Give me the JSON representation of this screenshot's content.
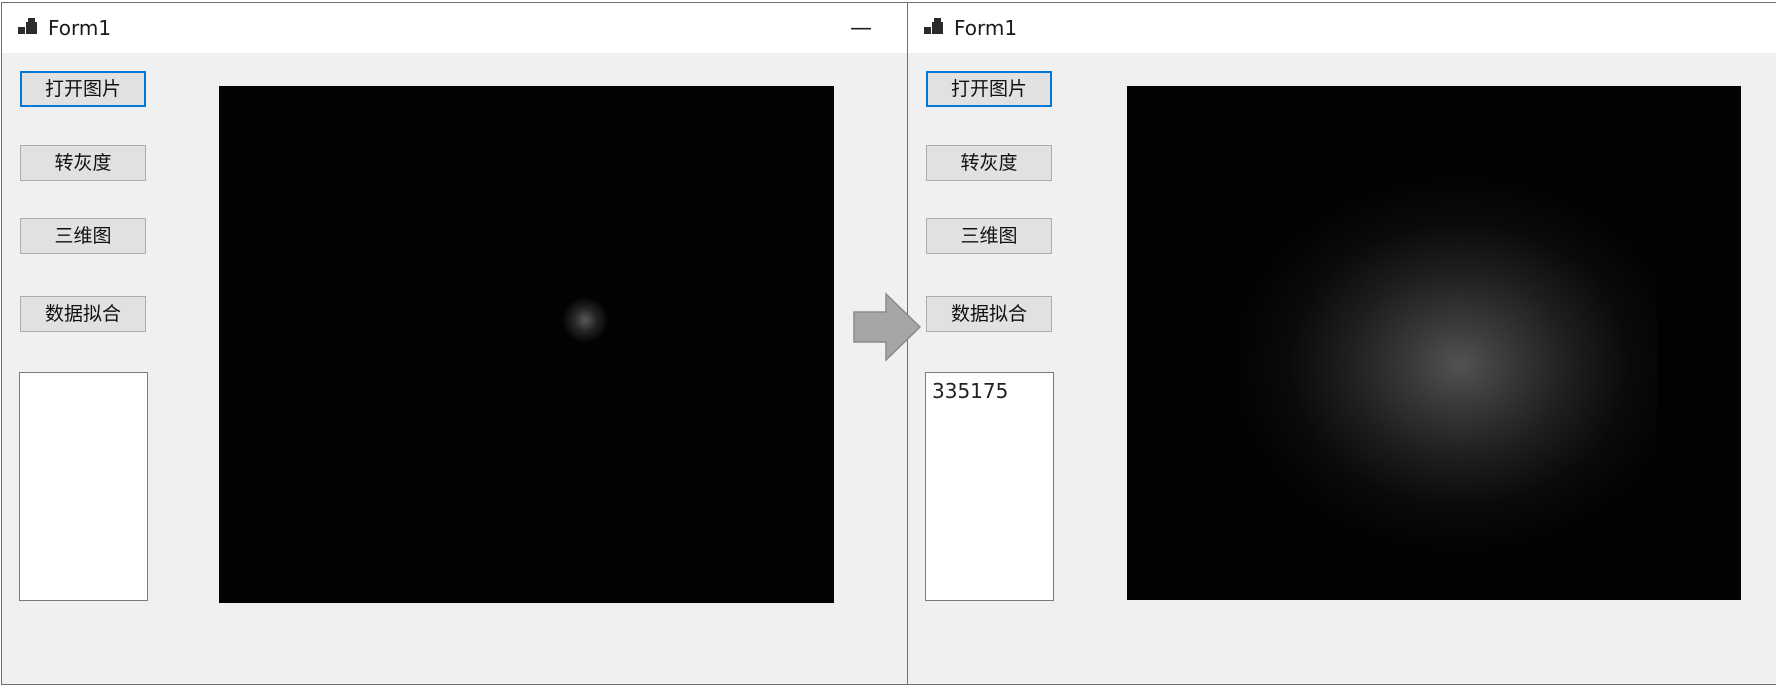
{
  "left_window": {
    "title": "Form1",
    "minimize_glyph": "—",
    "buttons": {
      "open_image": "打开图片",
      "grayscale": "转灰度",
      "three_d": "三维图",
      "data_fit": "数据拟合"
    },
    "output_text": ""
  },
  "right_window": {
    "title": "Form1",
    "buttons": {
      "open_image": "打开图片",
      "grayscale": "转灰度",
      "three_d": "三维图",
      "data_fit": "数据拟合"
    },
    "output_text": "335175"
  },
  "icons": {
    "app": "windows-form-icon",
    "transition": "right-arrow-icon",
    "minimize": "minimize-icon"
  },
  "colors": {
    "window_bg": "#f0f0f0",
    "titlebar_bg": "#ffffff",
    "focus_border": "#0078d7",
    "arrow_fill": "#a6a6a6",
    "picture_bg": "#020202"
  }
}
